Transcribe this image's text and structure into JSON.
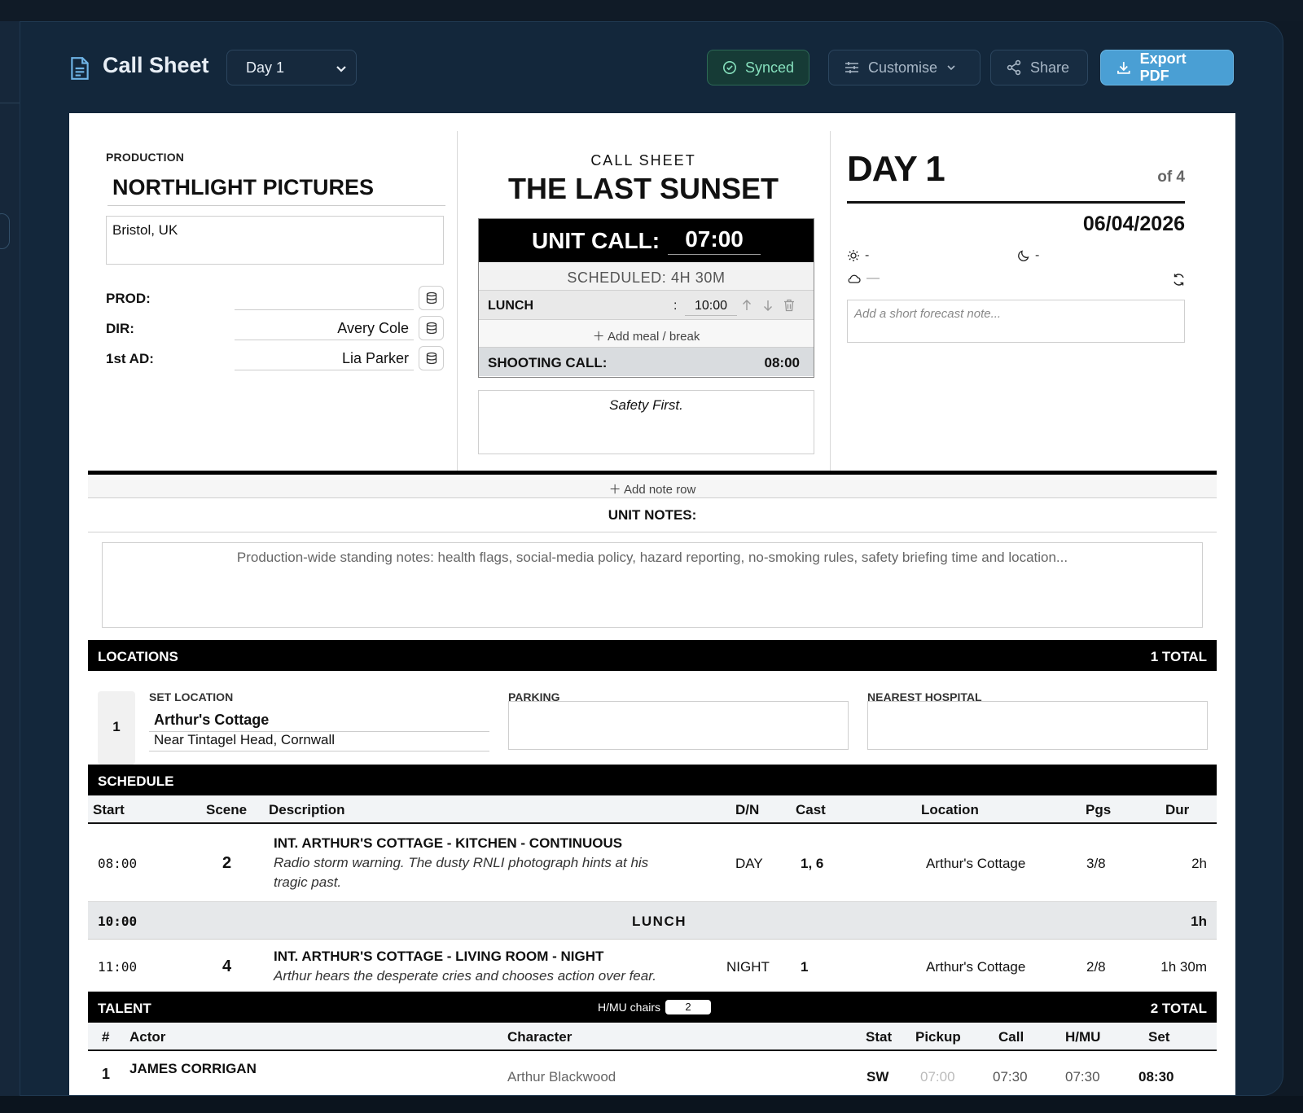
{
  "header": {
    "title": "Call Sheet",
    "day_select": "Day 1",
    "synced": "Synced",
    "customise": "Customise",
    "share": "Share",
    "export": "Export PDF"
  },
  "production": {
    "label": "PRODUCTION",
    "company": "NORTHLIGHT PICTURES",
    "address": "Bristol, UK",
    "crew": [
      {
        "key": "PROD:",
        "value": ""
      },
      {
        "key": "DIR:",
        "value": "Avery Cole"
      },
      {
        "key": "1st AD:",
        "value": "Lia Parker"
      }
    ]
  },
  "callsheet": {
    "label": "CALL SHEET",
    "title": "THE LAST SUNSET",
    "unit_call_label": "UNIT CALL:",
    "unit_call_time": "07:00",
    "scheduled": "SCHEDULED: 4H 30M",
    "meal_name": "LUNCH",
    "meal_colon": ":",
    "meal_time": "10:00",
    "add_meal": "Add meal / break",
    "shooting_call_label": "SHOOTING CALL:",
    "shooting_call_time": "08:00",
    "safety": "Safety First."
  },
  "day": {
    "title": "DAY 1",
    "of": "of 4",
    "date": "06/04/2026",
    "sunrise": "-",
    "sunset": "-",
    "weather": "—",
    "forecast_placeholder": "Add a short forecast note..."
  },
  "notes": {
    "add_row": "Add note row",
    "label": "UNIT NOTES:",
    "placeholder": "Production-wide standing notes: health flags, social-media policy, hazard reporting, no-smoking rules, safety briefing time and location..."
  },
  "locations": {
    "title": "LOCATIONS",
    "total": "1 TOTAL",
    "num": "1",
    "set_label": "SET LOCATION",
    "name": "Arthur's Cottage",
    "address": "Near Tintagel Head, Cornwall",
    "parking_label": "PARKING",
    "hospital_label": "NEAREST HOSPITAL"
  },
  "schedule": {
    "title": "SCHEDULE",
    "headers": [
      "Start",
      "Scene",
      "Description",
      "D/N",
      "Cast",
      "Location",
      "Pgs",
      "Dur"
    ],
    "rows": [
      {
        "start": "08:00",
        "scene": "2",
        "heading": "INT. ARTHUR'S COTTAGE - KITCHEN - CONTINUOUS",
        "desc1": "Radio storm warning. The dusty RNLI photograph hints at his",
        "desc2": "tragic past.",
        "dn": "DAY",
        "cast": "1, 6",
        "location": "Arthur's Cottage",
        "pgs": "3/8",
        "dur": "2h"
      },
      {
        "start": "11:00",
        "scene": "4",
        "heading": "INT. ARTHUR'S COTTAGE - LIVING ROOM - NIGHT",
        "desc1": "Arthur hears the desperate cries and chooses action over fear.",
        "desc2": "",
        "dn": "NIGHT",
        "cast": "1",
        "location": "Arthur's Cottage",
        "pgs": "2/8",
        "dur": "1h 30m"
      }
    ],
    "break": {
      "start": "10:00",
      "label": "LUNCH",
      "dur": "1h"
    }
  },
  "talent": {
    "title": "TALENT",
    "hmu_label": "H/MU chairs",
    "hmu_value": "2",
    "total": "2 TOTAL",
    "headers": [
      "#",
      "Actor",
      "Character",
      "Stat",
      "Pickup",
      "Call",
      "H/MU",
      "Set"
    ],
    "first": {
      "num": "1",
      "actor": "JAMES CORRIGAN",
      "character": "Arthur Blackwood",
      "stat": "SW",
      "pickup": "07:00",
      "call": "07:30",
      "hmu": "07:30",
      "set": "08:30"
    }
  },
  "colors": {
    "accent": "#4a9fd4",
    "synced": "#86e0bd",
    "bg": "#13273b"
  }
}
